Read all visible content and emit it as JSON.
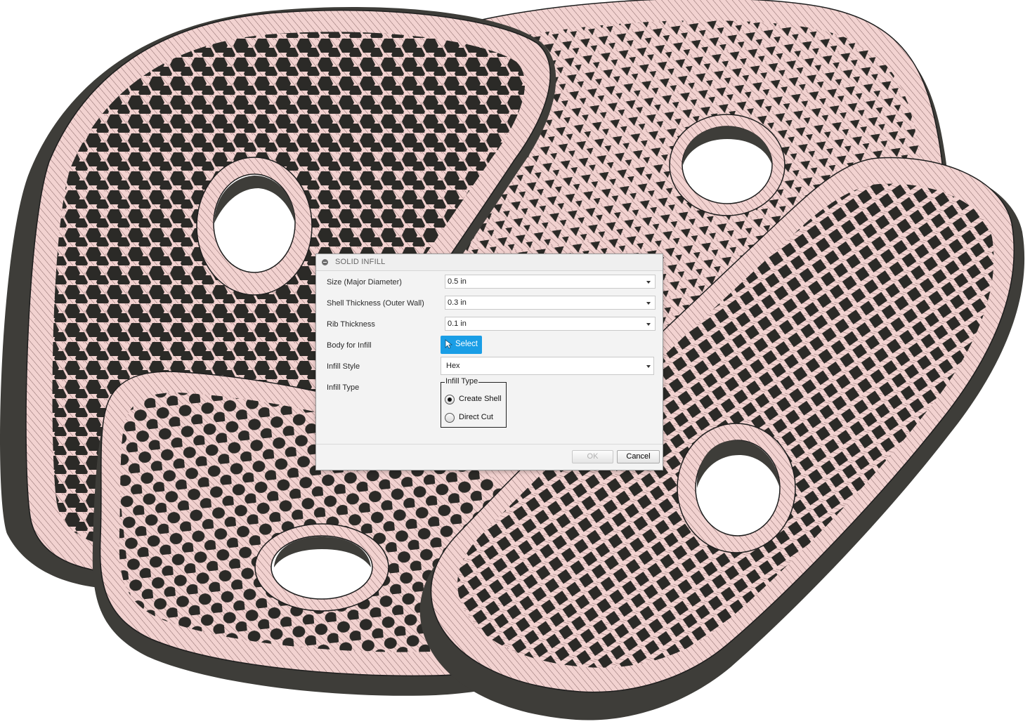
{
  "dialog": {
    "title": "SOLID INFILL",
    "rows": {
      "size": {
        "label": "Size (Major Diameter)",
        "value": "0.5 in"
      },
      "shell": {
        "label": "Shell Thickness (Outer Wall)",
        "value": "0.3 in"
      },
      "rib": {
        "label": "Rib Thickness",
        "value": "0.1 in"
      },
      "body": {
        "label": "Body for Infill",
        "button": "Select"
      },
      "style": {
        "label": "Infill Style",
        "value": "Hex"
      },
      "type": {
        "label": "Infill Type",
        "group_title": "Infill Type",
        "options": [
          "Create Shell",
          "Direct Cut"
        ],
        "selected": "Create Shell"
      }
    },
    "ok_label": "OK",
    "cancel_label": "Cancel"
  },
  "colors": {
    "accent": "#1a9ee6",
    "part_fill": "#f2d2d0",
    "part_edge": "#3e3d39",
    "hatch": "#7a5a5a"
  },
  "icons": [
    "collapse-icon",
    "cursor-arrow-icon"
  ]
}
